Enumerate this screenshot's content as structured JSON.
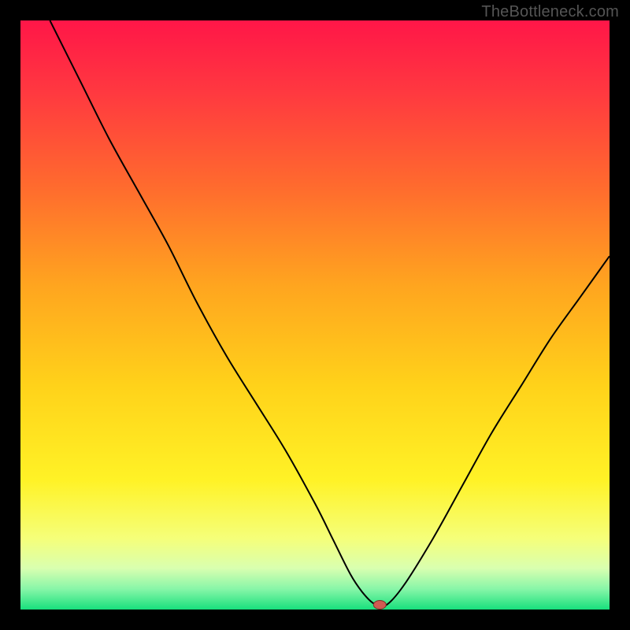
{
  "watermark": "TheBottleneck.com",
  "colors": {
    "page_bg": "#000000",
    "watermark": "#555555",
    "curve": "#000000",
    "marker_fill": "#cf5a52",
    "marker_stroke": "#7f2c28",
    "gradient_stops": [
      {
        "offset": 0.0,
        "color": "#ff1648"
      },
      {
        "offset": 0.12,
        "color": "#ff3840"
      },
      {
        "offset": 0.28,
        "color": "#ff6a2e"
      },
      {
        "offset": 0.45,
        "color": "#ffa51f"
      },
      {
        "offset": 0.62,
        "color": "#ffd21a"
      },
      {
        "offset": 0.78,
        "color": "#fff226"
      },
      {
        "offset": 0.88,
        "color": "#f5ff7a"
      },
      {
        "offset": 0.93,
        "color": "#d9ffb0"
      },
      {
        "offset": 0.965,
        "color": "#88f6a8"
      },
      {
        "offset": 1.0,
        "color": "#18e07d"
      }
    ]
  },
  "chart_data": {
    "type": "line",
    "title": "",
    "xlabel": "",
    "ylabel": "",
    "xlim": [
      0,
      100
    ],
    "ylim": [
      0,
      100
    ],
    "grid": false,
    "series": [
      {
        "name": "bottleneck-curve",
        "x": [
          5,
          10,
          15,
          20,
          25,
          30,
          35,
          40,
          45,
          50,
          53,
          56,
          58,
          60,
          62,
          65,
          70,
          75,
          80,
          85,
          90,
          95,
          100
        ],
        "y": [
          100,
          90,
          80,
          71,
          62,
          52,
          43,
          35,
          27,
          18,
          12,
          6,
          3,
          1,
          0.7,
          4,
          12,
          21,
          30,
          38,
          46,
          53,
          60
        ]
      }
    ],
    "marker": {
      "x": 61,
      "y": 0.8
    },
    "flat_region": {
      "x_start": 56,
      "x_end": 62,
      "y": 0.8
    }
  }
}
